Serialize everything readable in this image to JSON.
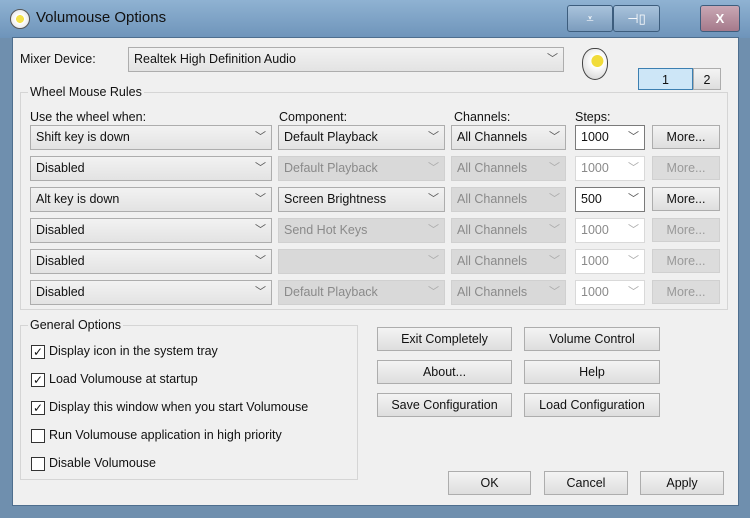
{
  "window": {
    "title": "Volumouse Options",
    "close_label": "X"
  },
  "mixer": {
    "label": "Mixer Device:",
    "value": "Realtek High Definition Audio"
  },
  "pages": [
    "1",
    "2"
  ],
  "rules": {
    "group_label": "Wheel Mouse Rules",
    "headers": {
      "wheel": "Use the wheel when:",
      "component": "Component:",
      "channels": "Channels:",
      "steps": "Steps:"
    },
    "rows": [
      {
        "wheel": "Shift key is down",
        "component": "Default Playback",
        "channels": "All Channels",
        "steps": "1000",
        "more": "More...",
        "enabled": true,
        "channels_enabled": true
      },
      {
        "wheel": "Disabled",
        "component": "Default Playback",
        "channels": "All Channels",
        "steps": "1000",
        "more": "More...",
        "enabled": false,
        "channels_enabled": false
      },
      {
        "wheel": "Alt key is down",
        "component": "Screen Brightness",
        "channels": "All Channels",
        "steps": "500",
        "more": "More...",
        "enabled": true,
        "channels_enabled": false
      },
      {
        "wheel": "Disabled",
        "component": "Send Hot Keys",
        "channels": "All Channels",
        "steps": "1000",
        "more": "More...",
        "enabled": false,
        "channels_enabled": false
      },
      {
        "wheel": "Disabled",
        "component": "",
        "channels": "All Channels",
        "steps": "1000",
        "more": "More...",
        "enabled": false,
        "channels_enabled": false
      },
      {
        "wheel": "Disabled",
        "component": "Default Playback",
        "channels": "All Channels",
        "steps": "1000",
        "more": "More...",
        "enabled": false,
        "channels_enabled": false
      }
    ]
  },
  "general": {
    "group_label": "General Options",
    "options": [
      {
        "label": "Display icon in the system tray",
        "checked": true
      },
      {
        "label": "Load Volumouse at startup",
        "checked": true
      },
      {
        "label": "Display this window when you start Volumouse",
        "checked": true
      },
      {
        "label": "Run Volumouse application in high priority",
        "checked": false
      },
      {
        "label": "Disable Volumouse",
        "checked": false
      }
    ]
  },
  "actions": {
    "exit": "Exit Completely",
    "volume": "Volume Control",
    "about": "About...",
    "help": "Help",
    "save": "Save Configuration",
    "load": "Load Configuration"
  },
  "footer": {
    "ok": "OK",
    "cancel": "Cancel",
    "apply": "Apply"
  }
}
